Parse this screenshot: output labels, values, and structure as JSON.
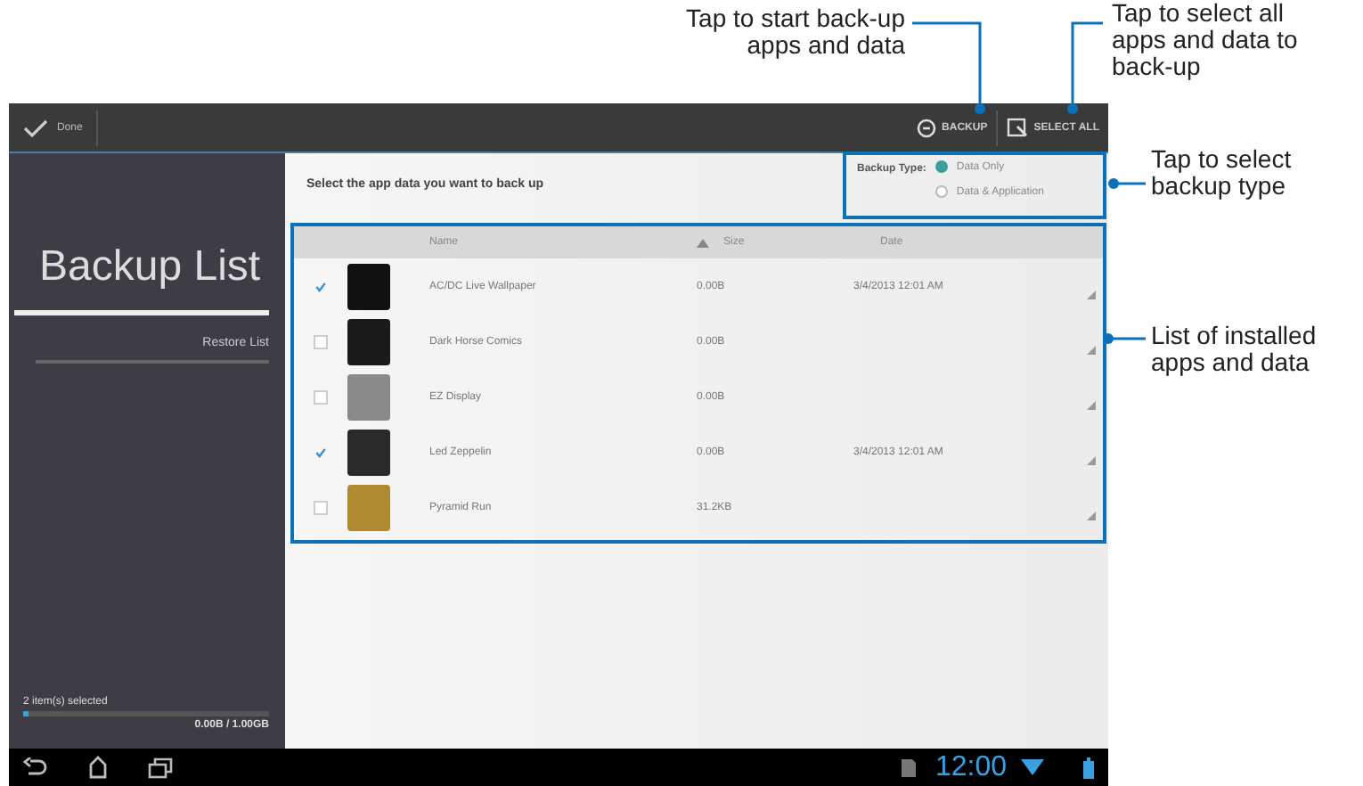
{
  "callouts": [
    {
      "text": "Tap to start back-up apps and data"
    },
    {
      "text": "Tap to select all apps and data to back-up"
    },
    {
      "text": "Tap to select backup type"
    },
    {
      "text": "List of installed apps and data"
    }
  ],
  "action_bar": {
    "done": "Done",
    "actions": [
      {
        "kind": "backup",
        "label": "BACKUP"
      },
      {
        "kind": "select_all",
        "label": "SELECT ALL"
      }
    ]
  },
  "sidebar": {
    "tabs": [
      {
        "label": "Backup List",
        "selected": true
      },
      {
        "label": "Restore List",
        "selected": false
      }
    ],
    "selection": {
      "label": "2 item(s) selected",
      "level": 0.02,
      "reading": "0.00B / 1.00GB"
    }
  },
  "content": {
    "prompt": "Select the app data you want to back up",
    "backup_type": {
      "label": "Backup Type:",
      "options": [
        {
          "label": "Data Only",
          "selected": true
        },
        {
          "label": "Data & Application",
          "selected": false
        }
      ]
    },
    "table": {
      "columns": [
        "Name",
        "Size",
        "Date"
      ],
      "rows": [
        {
          "checked": true,
          "color": "#111111",
          "name": "AC/DC Live Wallpaper",
          "size": "0.00B",
          "date": "3/4/2013 12:01 AM"
        },
        {
          "checked": false,
          "color": "#1a1a1a",
          "name": "Dark Horse Comics",
          "size": "0.00B"
        },
        {
          "checked": false,
          "color": "#8a8a8a",
          "name": "EZ Display",
          "size": "0.00B"
        },
        {
          "checked": true,
          "color": "#2a2a2a",
          "name": "Led Zeppelin",
          "size": "0.00B",
          "date": "3/4/2013 12:01 AM"
        },
        {
          "checked": false,
          "color": "#b08a30",
          "name": "Pyramid Run",
          "size": "31.2KB"
        }
      ]
    }
  },
  "nav_bar": {
    "time": "12:00"
  }
}
